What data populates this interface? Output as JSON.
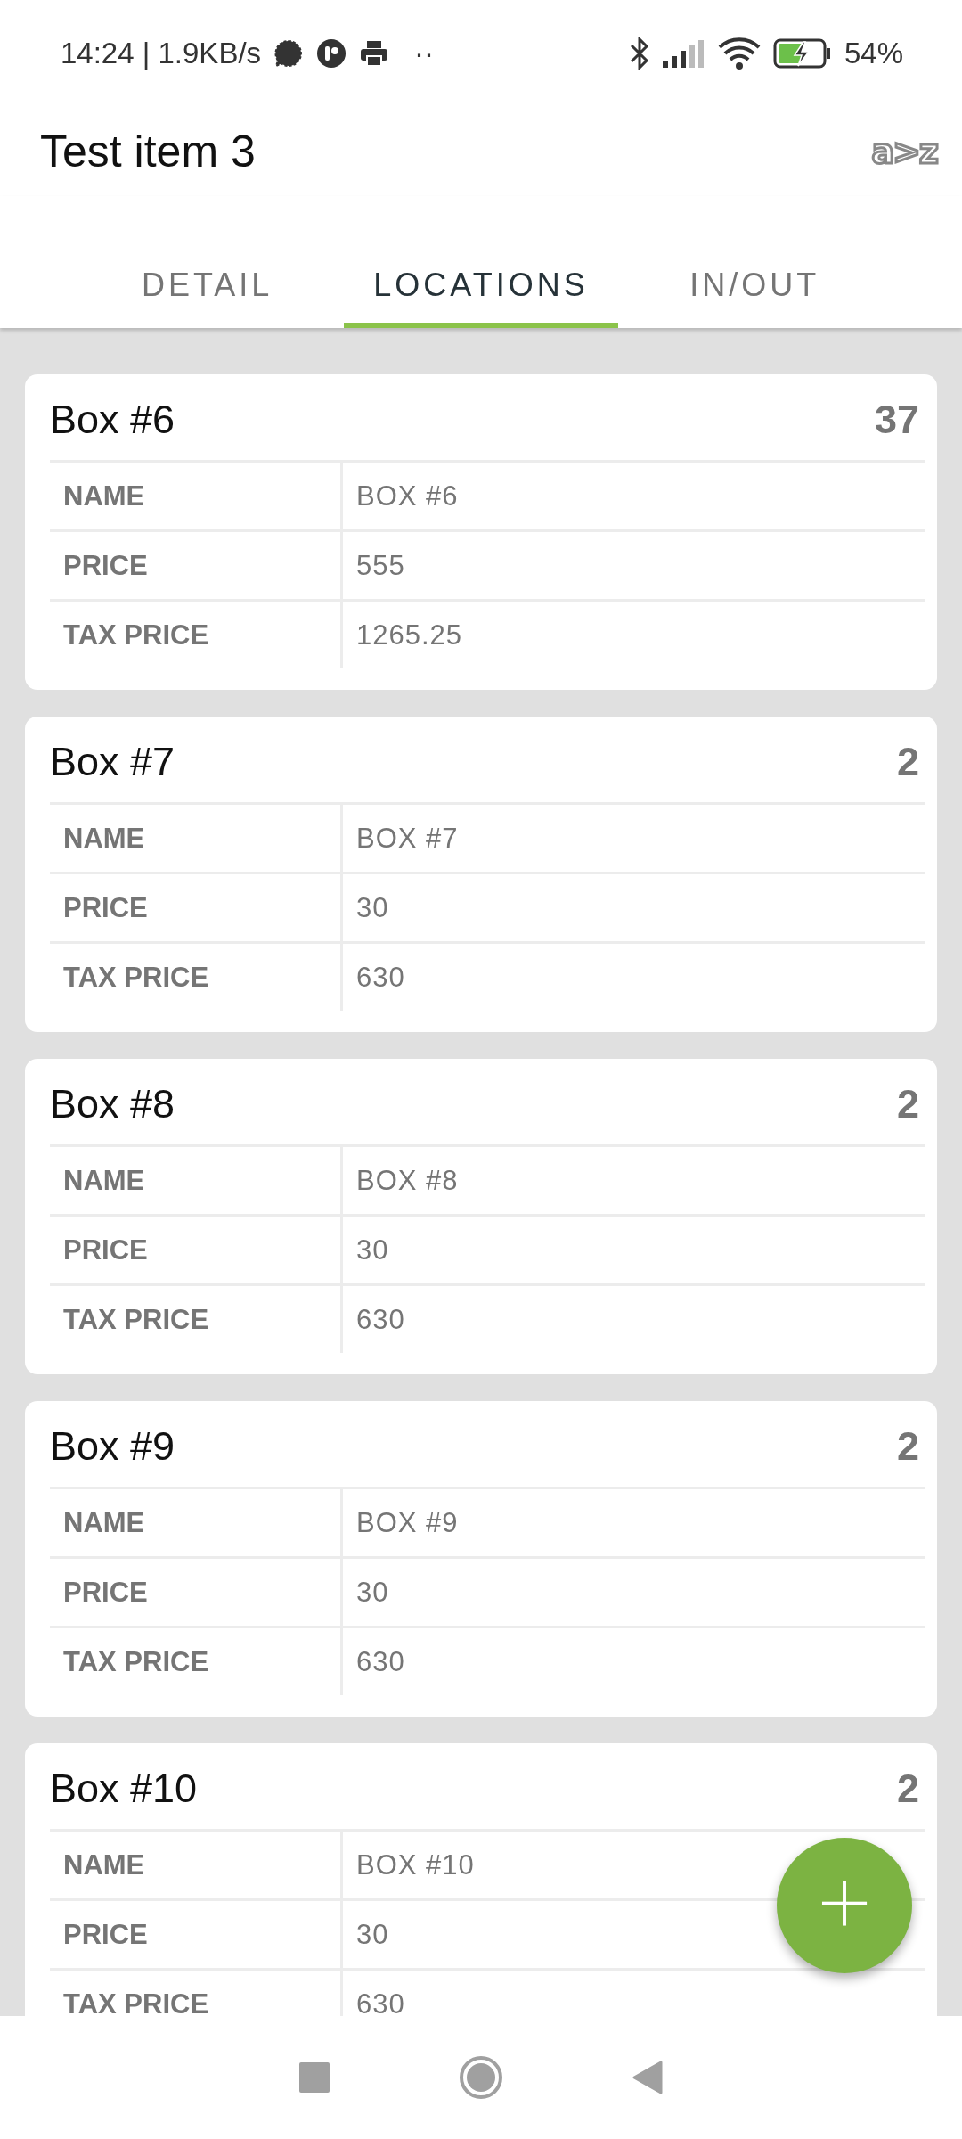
{
  "status_bar": {
    "time": "14:24 | 1.9KB/s",
    "dots": "··",
    "battery": "54%"
  },
  "toolbar": {
    "title": "Test item 3",
    "sort_button": "a>z"
  },
  "tabs": [
    {
      "label": "DETAIL",
      "selected": false
    },
    {
      "label": "LOCATIONS",
      "selected": true
    },
    {
      "label": "IN/OUT",
      "selected": false
    }
  ],
  "locations": [
    {
      "title": "Box #6",
      "count": "37",
      "rows": [
        {
          "label": "NAME",
          "value": "BOX #6"
        },
        {
          "label": "PRICE",
          "value": "555"
        },
        {
          "label": "TAX PRICE",
          "value": "1265.25"
        }
      ]
    },
    {
      "title": "Box #7",
      "count": "2",
      "rows": [
        {
          "label": "NAME",
          "value": "BOX #7"
        },
        {
          "label": "PRICE",
          "value": "30"
        },
        {
          "label": "TAX PRICE",
          "value": "630"
        }
      ]
    },
    {
      "title": "Box #8",
      "count": "2",
      "rows": [
        {
          "label": "NAME",
          "value": "BOX #8"
        },
        {
          "label": "PRICE",
          "value": "30"
        },
        {
          "label": "TAX PRICE",
          "value": "630"
        }
      ]
    },
    {
      "title": "Box #9",
      "count": "2",
      "rows": [
        {
          "label": "NAME",
          "value": "BOX #9"
        },
        {
          "label": "PRICE",
          "value": "30"
        },
        {
          "label": "TAX PRICE",
          "value": "630"
        }
      ]
    },
    {
      "title": "Box #10",
      "count": "2",
      "rows": [
        {
          "label": "NAME",
          "value": "BOX #10"
        },
        {
          "label": "PRICE",
          "value": "30"
        },
        {
          "label": "TAX PRICE",
          "value": "630"
        }
      ]
    }
  ],
  "fab": "+"
}
